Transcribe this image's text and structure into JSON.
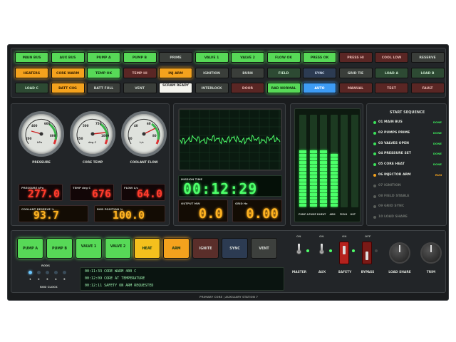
{
  "buttons": [
    {
      "label": "MAIN BUS",
      "state": "g"
    },
    {
      "label": "AUX BUS",
      "state": "g"
    },
    {
      "label": "PUMP A",
      "state": "g"
    },
    {
      "label": "PUMP B",
      "state": "g"
    },
    {
      "label": "PRIME",
      "state": "d"
    },
    {
      "label": "VALVE 1",
      "state": "g"
    },
    {
      "label": "VALVE 2",
      "state": "g"
    },
    {
      "label": "FLOW OK",
      "state": "g"
    },
    {
      "label": "PRESS OK",
      "state": "g"
    },
    {
      "label": "PRESS HI",
      "state": "r"
    },
    {
      "label": "COOL LOW",
      "state": "r"
    },
    {
      "label": "RESERVE",
      "state": "d"
    },
    {
      "label": "HEATERS",
      "state": "o"
    },
    {
      "label": "CORE WARM",
      "state": "o"
    },
    {
      "label": "TEMP OK",
      "state": "g"
    },
    {
      "label": "TEMP HI",
      "state": "r"
    },
    {
      "label": "INJ ARM",
      "state": "o"
    },
    {
      "label": "IGNITION",
      "state": "d"
    },
    {
      "label": "BURN",
      "state": "d"
    },
    {
      "label": "FIELD",
      "state": "dg"
    },
    {
      "label": "SYNC",
      "state": "bd"
    },
    {
      "label": "GRID TIE",
      "state": "d"
    },
    {
      "label": "LOAD A",
      "state": "dg"
    },
    {
      "label": "LOAD B",
      "state": "dg"
    },
    {
      "label": "LOAD C",
      "state": "dg"
    },
    {
      "label": "BATT CHG",
      "state": "o"
    },
    {
      "label": "BATT FULL",
      "state": "d"
    },
    {
      "label": "VENT",
      "state": "d"
    },
    {
      "label": "SCRAM READY",
      "state": "w"
    },
    {
      "label": "INTERLOCK",
      "state": "d"
    },
    {
      "label": "DOOR",
      "state": "r"
    },
    {
      "label": "RAD NORMAL",
      "state": "g"
    },
    {
      "label": "AUTO",
      "state": "b"
    },
    {
      "label": "MANUAL",
      "state": "r"
    },
    {
      "label": "TEST",
      "state": "r"
    },
    {
      "label": "FAULT",
      "state": "r"
    }
  ],
  "gauges": [
    {
      "label": "PRESSURE",
      "unit": "kPa",
      "ticks": [
        "200",
        "400",
        "600",
        "800"
      ]
    },
    {
      "label": "CORE TEMP",
      "unit": "deg C",
      "ticks": [
        "250",
        "500",
        "750",
        "1000"
      ]
    },
    {
      "label": "COOLANT FLOW",
      "unit": "L/s",
      "ticks": [
        "20",
        "40",
        "60",
        "80"
      ]
    }
  ],
  "readouts": {
    "pressure": {
      "label": "PRESSURE kPa",
      "value": "277.0"
    },
    "temp": {
      "label": "TEMP deg C",
      "value": "676"
    },
    "flow": {
      "label": "FLOW L/s",
      "value": "64.0"
    },
    "coolant_reserve": {
      "label": "COOLANT RESERVE %",
      "value": "93.7"
    },
    "rod_position": {
      "label": "ROD POSITION %",
      "value": "100.0"
    }
  },
  "mission": {
    "label": "MISSION TIME",
    "value": "00:12:29"
  },
  "output": {
    "label": "OUTPUT MW",
    "value": "0.0"
  },
  "grid": {
    "label": "GRID Hz",
    "value": "0.00"
  },
  "bars": {
    "labels": [
      "PUMP A",
      "PUMP B",
      "HEAT",
      "ARM",
      "FIELD",
      "OUT"
    ],
    "levels": [
      0.62,
      0.62,
      0.6,
      0.56,
      0,
      0
    ]
  },
  "sequence": {
    "title": "START SEQUENCE",
    "steps": [
      {
        "label": "01 MAIN BUS",
        "status": "DONE",
        "color": "#3be35a"
      },
      {
        "label": "02 PUMPS PRIME",
        "status": "DONE",
        "color": "#3be35a"
      },
      {
        "label": "03 VALVES OPEN",
        "status": "DONE",
        "color": "#3be35a"
      },
      {
        "label": "04 PRESSURE SET",
        "status": "DONE",
        "color": "#3be35a"
      },
      {
        "label": "05 CORE HEAT",
        "status": "DONE",
        "color": "#3be35a"
      },
      {
        "label": "06 INJECTOR ARM",
        "status": "RUN",
        "color": "#f4a21d"
      },
      {
        "label": "07 IGNITION",
        "status": "",
        "color": "#5a5e5a"
      },
      {
        "label": "08 FIELD STABLE",
        "status": "",
        "color": "#5a5e5a"
      },
      {
        "label": "09 GRID SYNC",
        "status": "",
        "color": "#5a5e5a"
      },
      {
        "label": "10 LOAD SHARE",
        "status": "",
        "color": "#5a5e5a"
      }
    ]
  },
  "bottom_buttons": [
    {
      "label": "PUMP A",
      "color": "#57d957"
    },
    {
      "label": "PUMP B",
      "color": "#57d957"
    },
    {
      "label": "VALVE 1",
      "color": "#57d957"
    },
    {
      "label": "VALVE 2",
      "color": "#57d957"
    },
    {
      "label": "HEAT",
      "color": "#f4c01d"
    },
    {
      "label": "ARM",
      "color": "#f4a21d"
    },
    {
      "label": "IGNITE",
      "color": "#5a2e2a"
    },
    {
      "label": "SYNC",
      "color": "#2c3b52"
    },
    {
      "label": "VENT",
      "color": "#3d403d"
    }
  ],
  "rods": {
    "label": "RODS",
    "clock_label": "ROD CLOCK",
    "numbers": [
      "1",
      "2",
      "3",
      "4",
      "5"
    ]
  },
  "log": [
    {
      "time": "00:11:33",
      "text": "CORE WARM  400 C"
    },
    {
      "time": "00:12:09",
      "text": "CORE AT TEMPERATURE"
    },
    {
      "time": "00:12:11",
      "text": "SAFETY ON  ARM REQUESTED"
    }
  ],
  "switches": [
    {
      "label": "MASTER",
      "state": "ON"
    },
    {
      "label": "AUX",
      "state": "ON"
    },
    {
      "label": "SAFETY",
      "state": "ON"
    },
    {
      "label": "BYPASS",
      "state": "OFF"
    }
  ],
  "knobs": [
    {
      "label": "LOAD SHARE"
    },
    {
      "label": "TRIM"
    }
  ],
  "footer": "PRIMARY CORE  |  AUXILIARY STATION 7"
}
